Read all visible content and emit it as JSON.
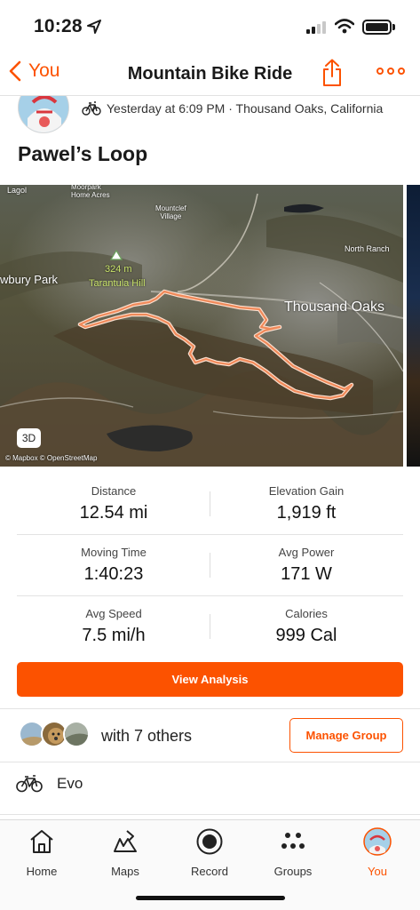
{
  "status_bar": {
    "time": "10:28"
  },
  "nav": {
    "back_label": "You",
    "title": "Mountain Bike Ride"
  },
  "activity": {
    "meta": "Yesterday at 6:09 PM · Thousand Oaks, California",
    "title": "Pawel’s Loop"
  },
  "map": {
    "labels": {
      "lagol": "Lagol",
      "moorpark": "Moorpark\nHome Acres",
      "mountclef": "Mountclef\nVillage",
      "north_ranch": "North Ranch",
      "newbury_park": "wbury Park",
      "peak_elevation": "324 m",
      "peak_name": "Tarantula Hill",
      "thousand_oaks": "Thousand Oaks"
    },
    "badge_3d": "3D",
    "attribution": "© Mapbox © OpenStreetMap",
    "route_color": "#f08a5a"
  },
  "stats": [
    {
      "label": "Distance",
      "value": "12.54 mi"
    },
    {
      "label": "Elevation Gain",
      "value": "1,919 ft"
    },
    {
      "label": "Moving Time",
      "value": "1:40:23"
    },
    {
      "label": "Avg Power",
      "value": "171 W"
    },
    {
      "label": "Avg Speed",
      "value": "7.5 mi/h"
    },
    {
      "label": "Calories",
      "value": "999 Cal"
    }
  ],
  "analysis_button": "View Analysis",
  "group": {
    "with_text": "with 7 others",
    "manage_button": "Manage Group"
  },
  "gear": {
    "name": "Evo",
    "icon": "bike-icon"
  },
  "tabs": [
    {
      "label": "Home",
      "icon": "home-icon"
    },
    {
      "label": "Maps",
      "icon": "maps-icon"
    },
    {
      "label": "Record",
      "icon": "record-icon"
    },
    {
      "label": "Groups",
      "icon": "groups-icon"
    },
    {
      "label": "You",
      "icon": "profile-avatar",
      "active": true
    }
  ],
  "colors": {
    "accent": "#fc5200",
    "text": "#1a1a1a"
  }
}
